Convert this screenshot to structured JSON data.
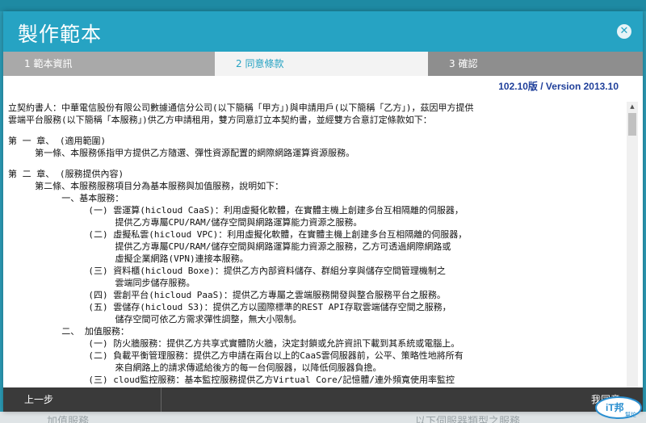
{
  "background": {
    "left_text": "加值服務",
    "right_text": "以下伺服器類型之服務"
  },
  "modal": {
    "title": "製作範本",
    "close_icon": "close-icon",
    "tabs": [
      {
        "label": "1 範本資訊",
        "state": "done"
      },
      {
        "label": "2 同意條款",
        "state": "active"
      },
      {
        "label": "3 確認",
        "state": "pending"
      }
    ],
    "version": "102.10版 / Version 2013.10",
    "terms_lines": [
      "立契約書人：中華電信股份有限公司數據通信分公司(以下簡稱「甲方」)與申請用戶(以下簡稱「乙方」)，茲因甲方提供",
      "雲端平台服務(以下簡稱「本服務」)供乙方申請租用，雙方同意訂立本契約書，並經雙方合意訂定條款如下：",
      "",
      "第 一 章、 (適用範圍)",
      "     第一條、本服務係指甲方提供乙方隨選、彈性資源配置的網際網路運算資源服務。",
      "",
      "第 二 章、 (服務提供內容)",
      "     第二條、本服務服務項目分為基本服務與加值服務，說明如下：",
      "          一、基本服務：",
      "               (一) 雲運算(hicloud CaaS)：利用虛擬化軟體，在實體主機上創建多台互相隔離的伺服器，",
      "                    提供乙方專屬CPU/RAM/儲存空間與網路運算能力資源之服務。",
      "               (二) 虛擬私雲(hicloud VPC)：利用虛擬化軟體，在實體主機上創建多台互相隔離的伺服器，",
      "                    提供乙方專屬CPU/RAM/儲存空間與網路運算能力資源之服務，乙方可透過網際網路或",
      "                    虛擬企業網路(VPN)連接本服務。",
      "               (三) 資料櫃(hicloud Boxe)：提供乙方內部資料儲存、群組分享與儲存空間管理機制之",
      "                    雲端同步儲存服務。",
      "               (四) 雲創平台(hicloud PaaS)：提供乙方專屬之雲端服務開發與整合服務平台之服務。",
      "               (五) 雲儲存(hicloud S3)：提供乙方以國際標準的REST API存取雲端儲存空間之服務，",
      "                    儲存空間可依乙方需求彈性調整，無大小限制。",
      "          二、 加值服務：",
      "               (一) 防火牆服務：提供乙方共享式實體防火牆，決定封鎖或允許資訊下載到其系統或電腦上。",
      "               (二) 負載平衡管理服務：提供乙方申請在兩台以上的CaaS雲伺服器前，公平、策略性地將所有",
      "                    來自網路上的請求傳遞給後方的每一台伺服器，以降低伺服器負擔。",
      "               (三) cloud監控服務：基本監控服務提供乙方Virtual Core/記憶體/連外頻寬使用率監控"
    ],
    "prev_label": "上一步",
    "next_label": "我同意"
  },
  "watermark": {
    "text_top": "iT邦",
    "text_bottom": "幫忙"
  }
}
